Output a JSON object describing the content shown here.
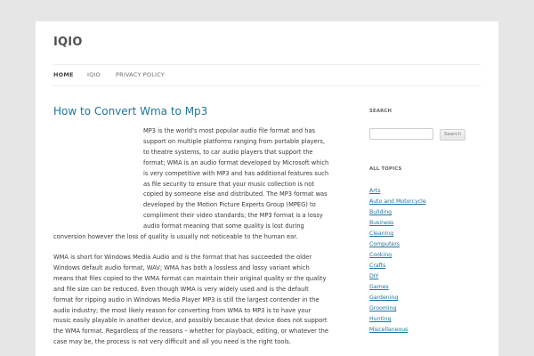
{
  "site": {
    "title": "IQIO"
  },
  "nav": {
    "items": [
      {
        "label": "HOME"
      },
      {
        "label": "IQIO"
      },
      {
        "label": "PRIVACY POLICY"
      }
    ]
  },
  "post": {
    "title": "How to Convert Wma to Mp3",
    "paragraphs": [
      "MP3 is the world's most popular audio file format and has support on multiple platforms ranging from portable players, to theatre systems, to car audio players that support the format; WMA is an audio format developed by Microsoft which is very competitive with MP3 and has additional features such as file security to ensure that your music collection is not copied by someone else and distributed. The MP3 format was developed by the Motion Picture Experts Group (MPEG) to compliment their video standards; the MP3 format is a lossy audio format meaning that some quality is lost during conversion however the loss of quality is usually not noticeable to the human ear.",
      "WMA is short for Windows Media Audio and is the format that has succeeded the older Windows default audio format, WAV; WMA has both a lossless and lossy variant which means that files copied to the WMA format can maintain their original quality or the quality and file size can be reduced. Even though WMA is very widely used and is the default format for ripping audio in Windows Media Player MP3 is still the largest contender in the audio industry; the most likely reason for converting from WMA to MP3 is to have your music easily playable in another device, and possibly because that device does not support the WMA format. Regardless of the reasons – whether for playback, editing, or whatever the case may be, the process is not very difficult and all you need is the right tools."
    ]
  },
  "sidebar": {
    "search": {
      "title": "SEARCH",
      "placeholder": "",
      "button_label": "Search"
    },
    "topics": {
      "title": "ALL TOPICS",
      "items": [
        "Arts",
        "Auto and Motorcycle",
        "Building",
        "Business",
        "Cleaning",
        "Computers",
        "Cooking",
        "Crafts",
        "DIY",
        "Games",
        "Gardening",
        "Grooming",
        "Hunting",
        "Miscellaneous"
      ]
    }
  }
}
